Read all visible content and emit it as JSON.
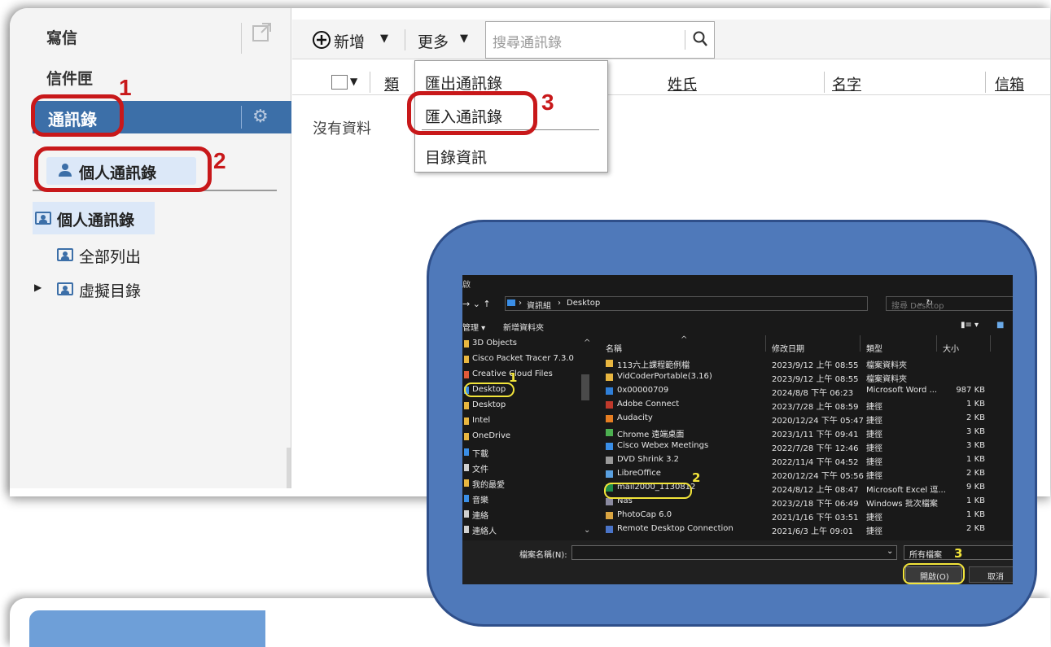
{
  "sidebar": {
    "compose": "寫信",
    "inbox": "信件匣",
    "contacts": "通訊錄",
    "personal_contacts_button": "個人通訊錄",
    "tree": {
      "root": "個人通訊錄",
      "items": [
        "全部列出",
        "虛擬目錄"
      ]
    }
  },
  "toolbar": {
    "add": "新增",
    "more": "更多",
    "search_placeholder": "搜尋通訊錄"
  },
  "table": {
    "columns": [
      "類",
      "姓氏",
      "名字",
      "信箱"
    ],
    "empty_text": "沒有資料"
  },
  "more_menu": {
    "items": [
      "匯出通訊錄",
      "匯入通訊錄",
      "目錄資訊"
    ]
  },
  "step_labels": [
    "1",
    "2",
    "3"
  ],
  "file_dialog": {
    "title_char": "啟",
    "breadcrumb": [
      "資訊組",
      "Desktop"
    ],
    "search_placeholder": "搜尋 Desktop",
    "toolbar": [
      "管理 ▾",
      "新增資料夾"
    ],
    "nav_items": [
      "3D Objects",
      "Cisco Packet Tracer 7.3.0",
      "Creative Cloud Files",
      "Desktop",
      "Desktop",
      "Intel",
      "OneDrive",
      "下載",
      "文件",
      "我的最愛",
      "音樂",
      "連絡",
      "連絡人"
    ],
    "columns": [
      "名稱",
      "修改日期",
      "類型",
      "大小"
    ],
    "files": [
      {
        "name": "113六上課程範例檔",
        "date": "2023/9/12 上午 08:55",
        "type": "檔案資料夾",
        "size": ""
      },
      {
        "name": "VidCoderPortable(3.16)",
        "date": "2023/9/12 上午 08:55",
        "type": "檔案資料夾",
        "size": ""
      },
      {
        "name": "0x00000709",
        "date": "2024/8/8 下午 06:23",
        "type": "Microsoft Word ...",
        "size": "987 KB"
      },
      {
        "name": "Adobe Connect",
        "date": "2023/7/28 上午 08:59",
        "type": "捷徑",
        "size": "1 KB"
      },
      {
        "name": "Audacity",
        "date": "2020/12/24 下午 05:47",
        "type": "捷徑",
        "size": "2 KB"
      },
      {
        "name": "Chrome 遠端桌面",
        "date": "2023/1/11 下午 09:41",
        "type": "捷徑",
        "size": "3 KB"
      },
      {
        "name": "Cisco Webex Meetings",
        "date": "2022/7/28 下午 12:46",
        "type": "捷徑",
        "size": "3 KB"
      },
      {
        "name": "DVD Shrink 3.2",
        "date": "2022/11/4 下午 04:52",
        "type": "捷徑",
        "size": "1 KB"
      },
      {
        "name": "LibreOffice",
        "date": "2020/12/24 下午 05:56",
        "type": "捷徑",
        "size": "2 KB"
      },
      {
        "name": "mail2000_1130812",
        "date": "2024/8/12 上午 08:47",
        "type": "Microsoft Excel 逗...",
        "size": "9 KB"
      },
      {
        "name": "Nas",
        "date": "2023/2/18 下午 06:49",
        "type": "Windows 批次檔案",
        "size": "1 KB"
      },
      {
        "name": "PhotoCap 6.0",
        "date": "2021/1/16 下午 03:51",
        "type": "捷徑",
        "size": "1 KB"
      },
      {
        "name": "Remote Desktop Connection",
        "date": "2021/6/3 上午 09:01",
        "type": "捷徑",
        "size": "2 KB"
      }
    ],
    "filename_label": "檔案名稱(N):",
    "filter_value": "所有檔案",
    "open_button": "開啟(O)",
    "cancel_button": "取消"
  },
  "colors": {
    "nav_active": "#3c6fa8",
    "annotation_red": "#c8181a",
    "annotation_yellow": "#f2e43a",
    "overlay_blue": "#4f79ba"
  }
}
